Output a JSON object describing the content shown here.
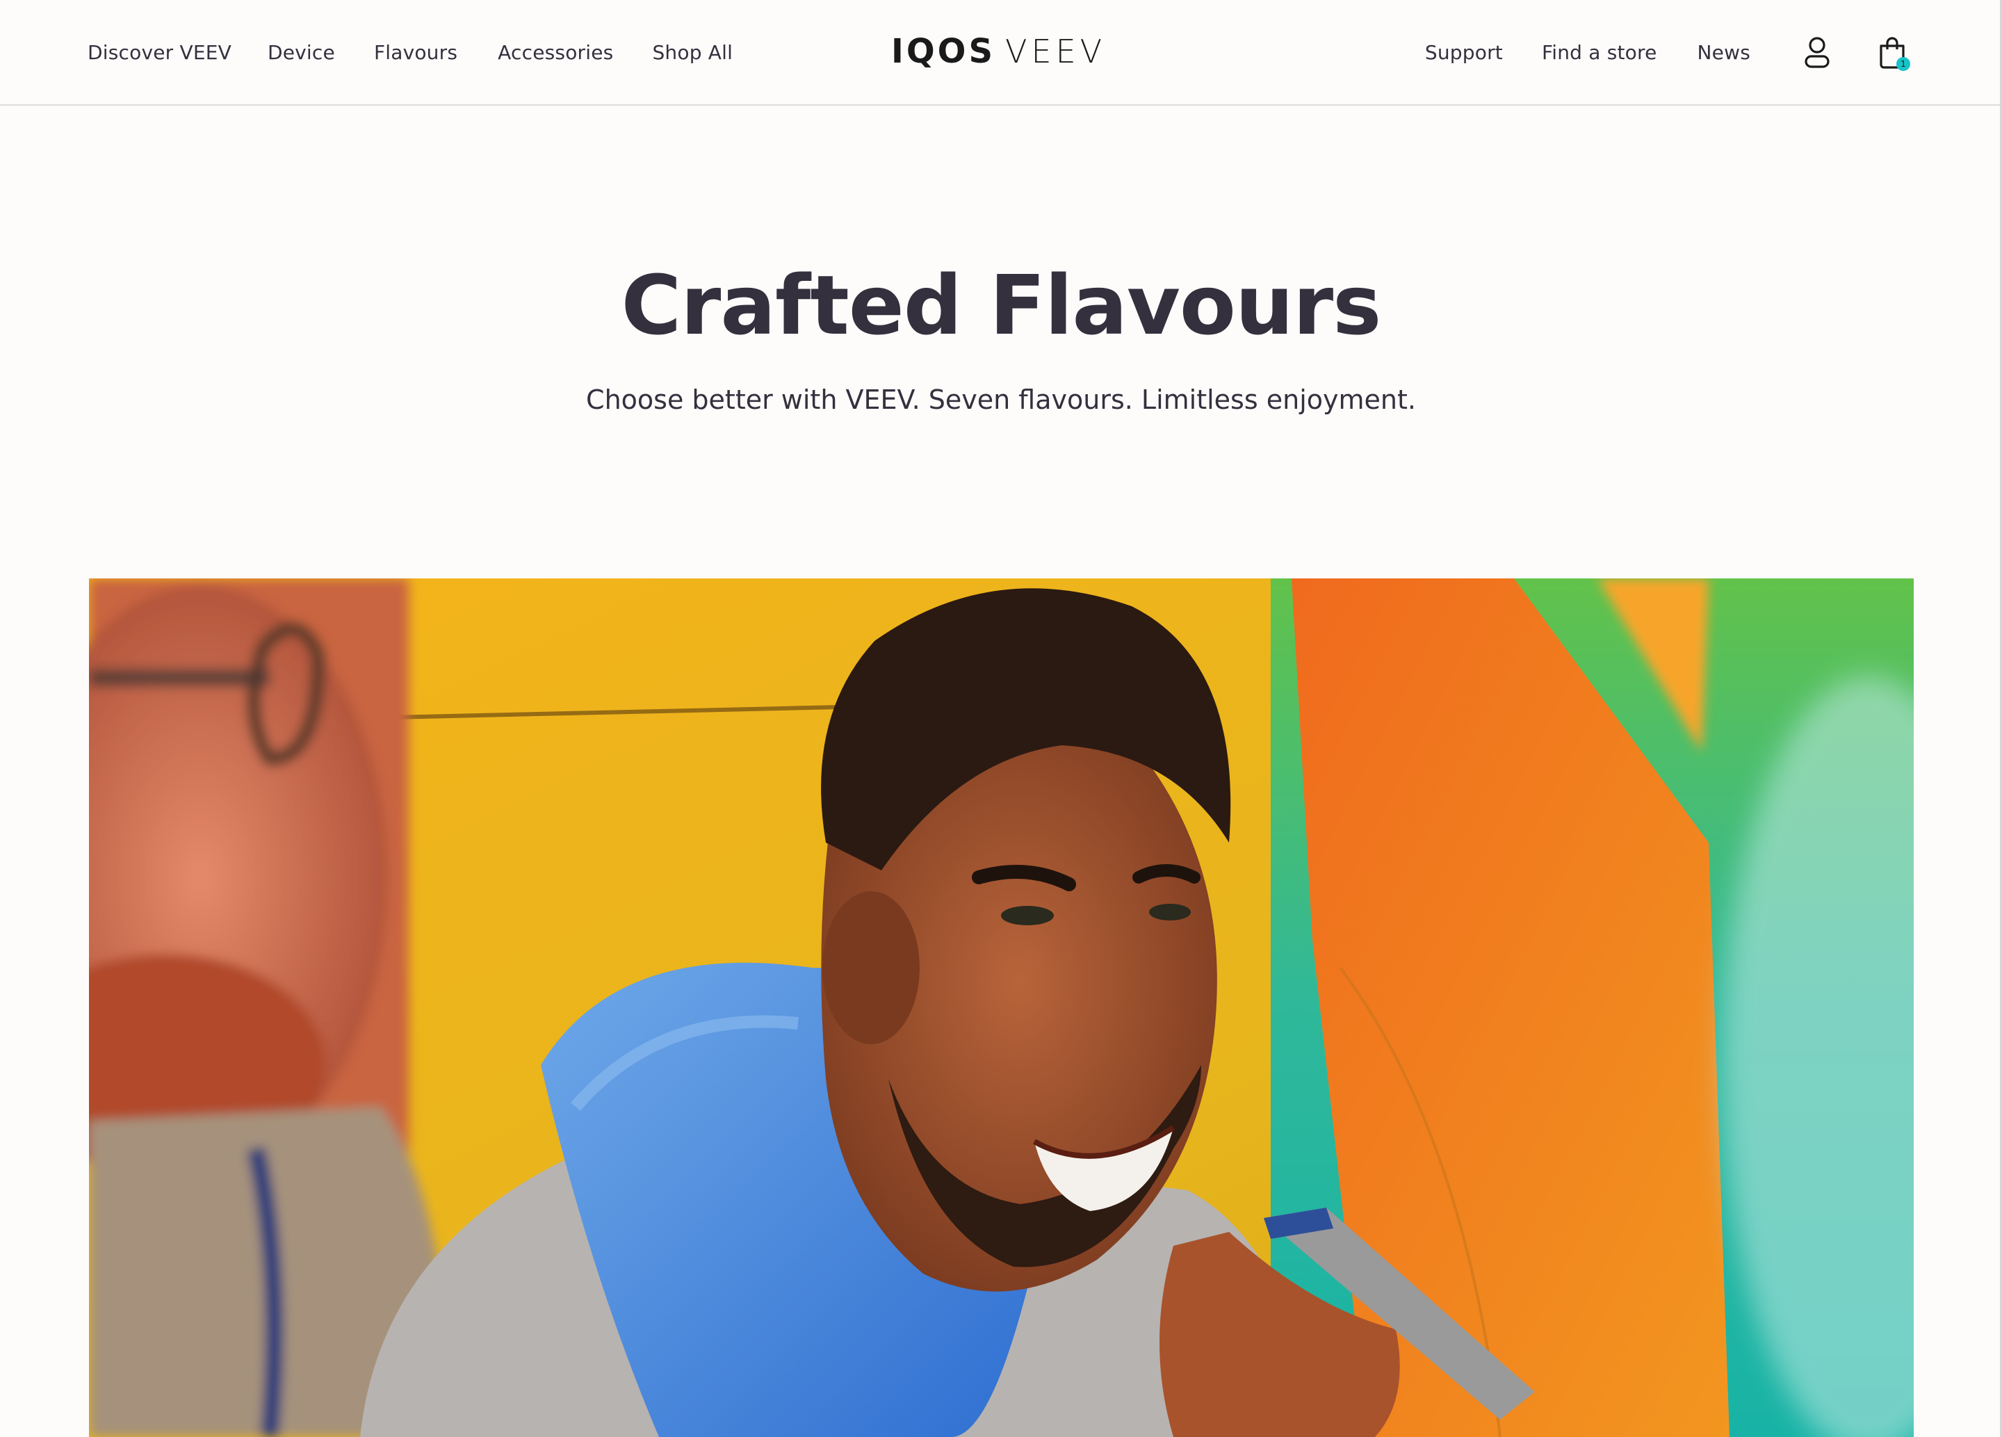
{
  "header": {
    "nav_left": [
      {
        "label": "Discover VEEV"
      },
      {
        "label": "Device"
      },
      {
        "label": "Flavours"
      },
      {
        "label": "Accessories"
      },
      {
        "label": "Shop All"
      }
    ],
    "logo": {
      "brand": "IQOS",
      "product": "VEEV"
    },
    "nav_right": [
      {
        "label": "Support"
      },
      {
        "label": "Find a store"
      },
      {
        "label": "News"
      }
    ],
    "account_icon": "user-icon",
    "cart": {
      "icon": "shopping-bag-icon",
      "count": "1"
    }
  },
  "hero": {
    "title": "Crafted Flavours",
    "subtitle": "Choose better with VEEV. Seven flavours. Limitless enjoyment."
  },
  "colors": {
    "text": "#34303d",
    "background": "#fdfcfb",
    "accent": "#17c3c9"
  }
}
